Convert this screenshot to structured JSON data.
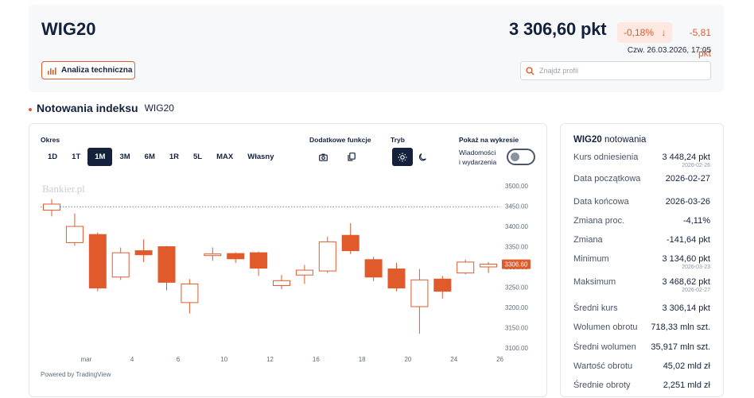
{
  "header": {
    "index_name": "WIG20",
    "price": "3 306,60 pkt",
    "change_pct": "-0,18%",
    "change_arrow": "↓",
    "change_abs": "-5,81 pkt",
    "timestamp": "Czw. 26.03.2026, 17:05",
    "ta_button_label": "Analiza techniczna",
    "search_placeholder": "Znajdź profil"
  },
  "section": {
    "title": "Notowania indeksu",
    "subtitle": "WIG20"
  },
  "chart_controls": {
    "period_label": "Okres",
    "periods": [
      "1D",
      "1T",
      "1M",
      "3M",
      "6M",
      "1R",
      "5L",
      "MAX",
      "Własny"
    ],
    "active_period": "1M",
    "functions_label": "Dodatkowe funkcje",
    "mode_label": "Tryb",
    "show_label": "Pokaż na wykresie",
    "events_line1": "Wiadomości",
    "events_line2": "i wydarzenia",
    "watermark": "Bankier.pl",
    "powered_by": "Powered by TradingView"
  },
  "colors": {
    "accent": "#e05a2c",
    "navy": "#14213d",
    "up_candle": "#e05a2c",
    "price_tag": "#e05a2c"
  },
  "chart_data": {
    "type": "candlestick",
    "y_ticks": [
      3500,
      3450,
      3400,
      3350,
      3300,
      3250,
      3200,
      3150,
      3100
    ],
    "y_tick_labels": [
      "3500.00",
      "3450.00",
      "3400.00",
      "3350.00",
      "3300.00",
      "3250.00",
      "3200.00",
      "3150.00",
      "3100.00"
    ],
    "ylim": [
      3090,
      3530
    ],
    "x_tick_labels": [
      {
        "label": "mar",
        "at": 1.5
      },
      {
        "label": "4",
        "at": 3.5
      },
      {
        "label": "6",
        "at": 5.5
      },
      {
        "label": "10",
        "at": 7.5
      },
      {
        "label": "12",
        "at": 9.5
      },
      {
        "label": "16",
        "at": 11.5
      },
      {
        "label": "18",
        "at": 13.5
      },
      {
        "label": "20",
        "at": 15.5
      },
      {
        "label": "24",
        "at": 17.5
      },
      {
        "label": "26",
        "at": 19.5
      }
    ],
    "reference_level": 3448.24,
    "last_price_label": "3306.60",
    "last_price": 3306.6,
    "candles": [
      {
        "o": 3440,
        "h": 3468,
        "l": 3425,
        "c": 3455
      },
      {
        "o": 3360,
        "h": 3432,
        "l": 3352,
        "c": 3400
      },
      {
        "o": 3380,
        "h": 3385,
        "l": 3240,
        "c": 3248
      },
      {
        "o": 3275,
        "h": 3348,
        "l": 3268,
        "c": 3335
      },
      {
        "o": 3340,
        "h": 3368,
        "l": 3312,
        "c": 3330
      },
      {
        "o": 3350,
        "h": 3352,
        "l": 3242,
        "c": 3262
      },
      {
        "o": 3212,
        "h": 3270,
        "l": 3185,
        "c": 3258
      },
      {
        "o": 3328,
        "h": 3348,
        "l": 3315,
        "c": 3332
      },
      {
        "o": 3333,
        "h": 3336,
        "l": 3310,
        "c": 3320
      },
      {
        "o": 3335,
        "h": 3338,
        "l": 3278,
        "c": 3297
      },
      {
        "o": 3254,
        "h": 3280,
        "l": 3245,
        "c": 3266
      },
      {
        "o": 3280,
        "h": 3305,
        "l": 3258,
        "c": 3292
      },
      {
        "o": 3290,
        "h": 3375,
        "l": 3285,
        "c": 3362
      },
      {
        "o": 3378,
        "h": 3408,
        "l": 3332,
        "c": 3340
      },
      {
        "o": 3318,
        "h": 3325,
        "l": 3265,
        "c": 3275
      },
      {
        "o": 3295,
        "h": 3310,
        "l": 3240,
        "c": 3248
      },
      {
        "o": 3202,
        "h": 3295,
        "l": 3135,
        "c": 3268
      },
      {
        "o": 3270,
        "h": 3278,
        "l": 3222,
        "c": 3240
      },
      {
        "o": 3285,
        "h": 3318,
        "l": 3282,
        "c": 3312
      },
      {
        "o": 3300,
        "h": 3312,
        "l": 3285,
        "c": 3307
      }
    ]
  },
  "stats": {
    "title_bold": "WIG20",
    "title_rest": "notowania",
    "rows": [
      {
        "key": "Kurs odniesienia",
        "value": "3 448,24 pkt",
        "date": "2026-02-26"
      },
      {
        "key": "Data początkowa",
        "value": "2026-02-27",
        "date": ""
      },
      {
        "key": "Data końcowa",
        "value": "2026-03-26",
        "date": ""
      },
      {
        "key": "Zmiana proc.",
        "value": "-4,11%",
        "date": ""
      },
      {
        "key": "Zmiana",
        "value": "-141,64 pkt",
        "date": ""
      },
      {
        "key": "Minimum",
        "value": "3 134,60 pkt",
        "date": "2026-03-23"
      },
      {
        "key": "Maksimum",
        "value": "3 468,62 pkt",
        "date": "2026-02-27"
      },
      {
        "key": "Średni kurs",
        "value": "3 306,14 pkt",
        "date": ""
      },
      {
        "key": "Wolumen obrotu",
        "value": "718,33 mln szt.",
        "date": ""
      },
      {
        "key": "Średni wolumen",
        "value": "35,917 mln szt.",
        "date": ""
      },
      {
        "key": "Wartość obrotu",
        "value": "45,02 mld zł",
        "date": ""
      },
      {
        "key": "Średnie obroty",
        "value": "2,251 mld zł",
        "date": ""
      }
    ]
  }
}
